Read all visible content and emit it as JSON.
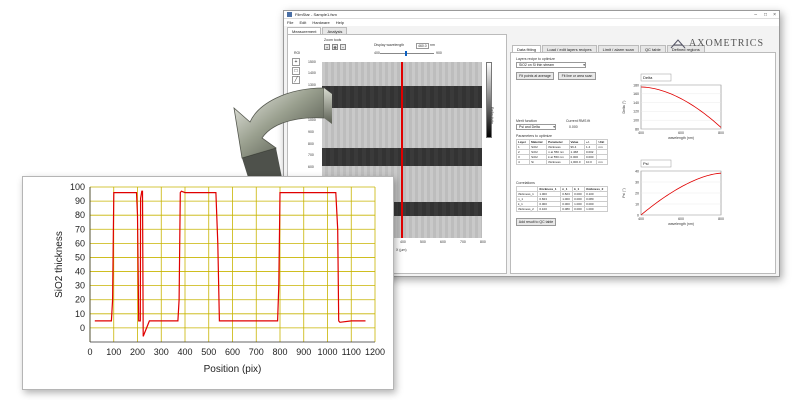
{
  "window": {
    "title": "FilmStar - Sample1.fsm",
    "menu": [
      "File",
      "Edit",
      "Hardware",
      "Help"
    ],
    "left_tabs": [
      "Measurement",
      "Analysis"
    ],
    "zoom_label": "Zoom tools",
    "wavelength_label": "Display wavelength",
    "wavelength_value": "460.0",
    "wavelength_unit": "nm",
    "wavelength_min": "400",
    "wavelength_max": "900",
    "roi_label": "ROI",
    "x_axis_label": "X (µm)",
    "y_axis_ticks": [
      "1500",
      "1400",
      "1300",
      "1200",
      "1100",
      "1000",
      "900",
      "800",
      "700",
      "600",
      "500",
      "400",
      "300",
      "200",
      "100",
      "0"
    ],
    "x_axis_ticks": [
      "0",
      "100",
      "200",
      "300",
      "400",
      "500",
      "600",
      "700",
      "800"
    ],
    "colorbar_label": "Reflectivity",
    "right_tabs": [
      "Data fitting",
      "Load / edit layers recipes",
      "Limit / alarm scan",
      "QC table",
      "Defined regions"
    ],
    "logo_text": "AXOMETRICS",
    "layers_label": "Layers recipe to optimize",
    "layers_value": "SiO2 on Si thin stream",
    "fit_avg_button": "Fit points at average",
    "fit_scan_button": "Fit line or area scan",
    "merit_label": "Merit function",
    "merit_value": "Psi and Delta",
    "rms_label": "Current RMS fit",
    "rms_value": "0.000",
    "params_label": "Parameters to optimize",
    "params_headers": [
      "Layer",
      "Material",
      "Parameter",
      "Value",
      "+/-",
      "Unit"
    ],
    "params_rows": [
      [
        "1",
        "SiO2",
        "thickness",
        "96.4",
        "1.4",
        "nm"
      ],
      [
        "2",
        "SiO2",
        "n at 550 nm",
        "1.468",
        "0.002",
        ""
      ],
      [
        "3",
        "SiO2",
        "k at 550 nm",
        "0.000",
        "0.000",
        ""
      ],
      [
        "4",
        "Si",
        "thickness",
        "1,000.0",
        "10.0",
        "nm"
      ]
    ],
    "corr_label": "Correlations",
    "corr_headers": [
      "",
      "thickness_1",
      "n_1",
      "k_1",
      "thickness_2"
    ],
    "corr_rows": [
      [
        "thickness_1",
        "1.000",
        "0.823",
        "0.000",
        "0.100"
      ],
      [
        "n_1",
        "0.823",
        "1.000",
        "0.000",
        "0.080"
      ],
      [
        "k_1",
        "0.000",
        "0.000",
        "1.000",
        "0.000"
      ],
      [
        "thickness_2",
        "0.100",
        "0.080",
        "0.000",
        "1.000"
      ]
    ],
    "qc_button": "Add result to QC table",
    "chart1_dropdown": "Delta",
    "chart1_ylabel": "Delta (°)",
    "chart1_xlabel": "wavelength (nm)",
    "chart1_xticks": [
      "400",
      "600",
      "800"
    ],
    "chart1_yticks": [
      "180",
      "160",
      "140",
      "120",
      "100",
      "80"
    ],
    "chart2_dropdown": "Psi",
    "chart2_ylabel": "Psi (°)",
    "chart2_xlabel": "wavelength (nm)",
    "chart2_xticks": [
      "400",
      "600",
      "800"
    ],
    "chart2_yticks": [
      "40",
      "30",
      "20",
      "10",
      "0"
    ]
  },
  "colors": {
    "plot_line": "#e00000",
    "grid": "#c8b400",
    "micro_dark": "#2b2b2b",
    "accent_blue": "#0a5fc2"
  },
  "chart_data": {
    "type": "line",
    "xlabel": "Position (pix)",
    "ylabel": "SiO2 thickness",
    "xlim": [
      0,
      1200
    ],
    "ylim": [
      -10,
      100
    ],
    "xticks": [
      0,
      100,
      200,
      300,
      400,
      500,
      600,
      700,
      800,
      900,
      1000,
      1100,
      1200
    ],
    "yticks": [
      0,
      10,
      20,
      30,
      40,
      50,
      60,
      70,
      80,
      90,
      100
    ],
    "grid": true,
    "series": [
      {
        "x": [
          20,
          80,
          90,
          95,
          100,
          150,
          196,
          200,
          205,
          212,
          213,
          218,
          221,
          224,
          250,
          300,
          370,
          375,
          380,
          385,
          400,
          450,
          530,
          538,
          545,
          550,
          600,
          700,
          790,
          795,
          800,
          805,
          850,
          950,
          1035,
          1043,
          1047,
          1052,
          1100,
          1160
        ],
        "y": [
          5,
          5,
          5,
          20,
          96,
          96,
          96,
          80,
          5,
          5,
          92,
          97,
          97,
          -6,
          5,
          5,
          5,
          20,
          96,
          97,
          96,
          96,
          96,
          60,
          5,
          5,
          5,
          5,
          5,
          30,
          96,
          96,
          96,
          96,
          96,
          70,
          5,
          4,
          5,
          5
        ]
      }
    ]
  }
}
